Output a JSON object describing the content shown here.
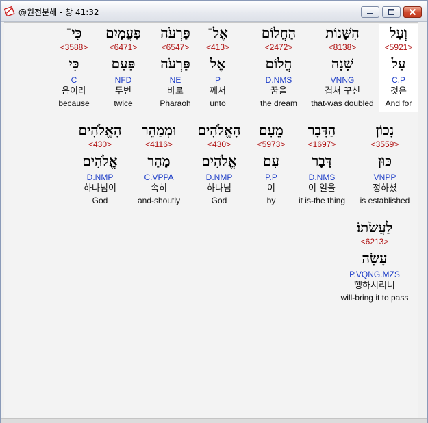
{
  "window": {
    "title": "@원전분해 - 창 41:32"
  },
  "words": [
    {
      "heb": "וְעַל",
      "strong": "<5921>",
      "lemma": "עַל",
      "morph": "C.P",
      "kor": "것은",
      "eng": "And for",
      "selected": true
    },
    {
      "heb": "הִשָּׁנוֹת",
      "strong": "<8138>",
      "lemma": "שָׁנָה",
      "morph": "VNNG",
      "kor": "겹쳐 꾸신",
      "eng": "that-was doubled"
    },
    {
      "heb": "הַחֲלוֹם",
      "strong": "<2472>",
      "lemma": "חֲלוֹם",
      "morph": "D.NMS",
      "kor": "꿈을",
      "eng": "the dream"
    },
    {
      "heb": "אֶל־",
      "strong": "<413>",
      "lemma": "אֶל",
      "morph": "P",
      "kor": "께서",
      "eng": "unto"
    },
    {
      "heb": "פַּרְעֹה",
      "strong": "<6547>",
      "lemma": "פַּרְעֹה",
      "morph": "NE",
      "kor": "바로",
      "eng": "Pharaoh"
    },
    {
      "heb": "פַּעֲמָיִם",
      "strong": "<6471>",
      "lemma": "פַּעַם",
      "morph": "NFD",
      "kor": "두번",
      "eng": "twice"
    },
    {
      "heb": "כִּי־",
      "strong": "<3588>",
      "lemma": "כִּי",
      "morph": "C",
      "kor": "음이라",
      "eng": "because"
    },
    {
      "heb": "נָכוֹן",
      "strong": "<3559>",
      "lemma": "כּוּן",
      "morph": "VNPP",
      "kor": "정하셨",
      "eng": "is established"
    },
    {
      "heb": "הַדָּבָר",
      "strong": "<1697>",
      "lemma": "דָּבָר",
      "morph": "D.NMS",
      "kor": "이 일을",
      "eng": "it is-the thing"
    },
    {
      "heb": "מֵעִם",
      "strong": "<5973>",
      "lemma": "עִם",
      "morph": "P.P",
      "kor": "이",
      "eng": "by"
    },
    {
      "heb": "הָאֱלֹהִים",
      "strong": "<430>",
      "lemma": "אֱלֹהִים",
      "morph": "D.NMP",
      "kor": "하나님",
      "eng": "God"
    },
    {
      "heb": "וּמְמַהֵר",
      "strong": "<4116>",
      "lemma": "מָהַר",
      "morph": "C.VPPA",
      "kor": "속히",
      "eng": "and-shoutly"
    },
    {
      "heb": "הָאֱלֹהִים",
      "strong": "<430>",
      "lemma": "אֱלֹהִים",
      "morph": "D.NMP",
      "kor": "하나님이",
      "eng": "God"
    },
    {
      "heb": "לַעֲשֹׂתוֹ׃",
      "strong": "<6213>",
      "lemma": "עָשָׂה",
      "morph": "P.VQNG.MZS",
      "kor": "행하시리니",
      "eng": "will-bring it to pass"
    }
  ]
}
